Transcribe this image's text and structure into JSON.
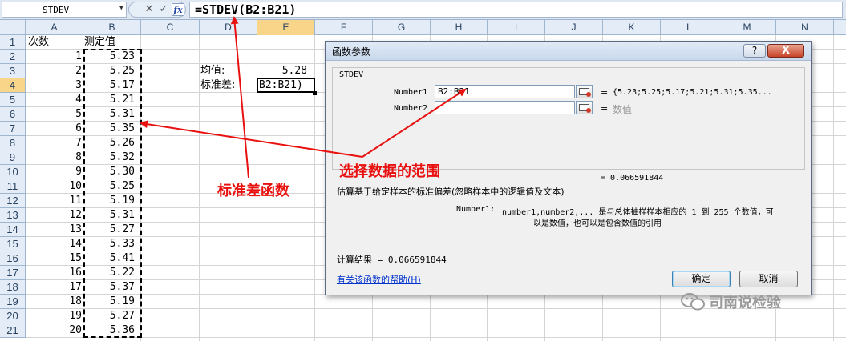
{
  "formula_bar": {
    "name_box": "STDEV",
    "cancel_icon": "✕",
    "enter_icon": "✓",
    "fx_label": "fx",
    "formula": "=STDEV(B2:B21)"
  },
  "columns": [
    "A",
    "B",
    "C",
    "D",
    "E",
    "F",
    "G",
    "H",
    "I",
    "J",
    "K",
    "L",
    "M",
    "N"
  ],
  "rows": [
    "1",
    "2",
    "3",
    "4",
    "5",
    "6",
    "7",
    "8",
    "9",
    "10",
    "11",
    "12",
    "13",
    "14",
    "15",
    "16",
    "17",
    "18",
    "19",
    "20",
    "21"
  ],
  "sheet": {
    "a1": "次数",
    "b1": "测定值",
    "a_values": [
      "1",
      "2",
      "3",
      "4",
      "5",
      "6",
      "7",
      "8",
      "9",
      "10",
      "11",
      "12",
      "13",
      "14",
      "15",
      "16",
      "17",
      "18",
      "19",
      "20"
    ],
    "b_values": [
      "5.23",
      "5.25",
      "5.17",
      "5.21",
      "5.31",
      "5.35",
      "5.26",
      "5.32",
      "5.30",
      "5.25",
      "5.19",
      "5.31",
      "5.27",
      "5.33",
      "5.41",
      "5.22",
      "5.37",
      "5.19",
      "5.27",
      "5.36"
    ],
    "d3": "均值:",
    "e3": "5.28",
    "d4": "标准差:",
    "e4_editing": "(B2:B21)",
    "e4_visible": "B2:B21)"
  },
  "dialog": {
    "title": "函数参数",
    "help_button": "?",
    "close_button": "X",
    "function_name": "STDEV",
    "number1_label": "Number1",
    "number1_value": "B2:B21",
    "number1_result": "{5.23;5.25;5.17;5.21;5.31;5.35...",
    "number2_label": "Number2",
    "number2_value": "",
    "number2_result": "数值",
    "equals": "=",
    "formula_result_line": "= 0.066591844",
    "description": "估算基于给定样本的标准偏差(忽略样本中的逻辑值及文本)",
    "arg_help_name": "Number1:",
    "arg_help_line1": "number1,number2,... 是与总体抽样样本相应的 1 到 255 个数值，可",
    "arg_help_line2": "以是数值，也可以是包含数值的引用",
    "calc_result": "计算结果 = 0.066591844",
    "help_link": "有关该函数的帮助(H)",
    "ok_button": "确定",
    "cancel_button": "取消"
  },
  "annotations": {
    "select_range": "选择数据的范围",
    "stdev_function": "标准差函数",
    "color": "#e8110f"
  },
  "watermark": {
    "text": "司南说检验",
    "icon": "wechat-icon"
  }
}
